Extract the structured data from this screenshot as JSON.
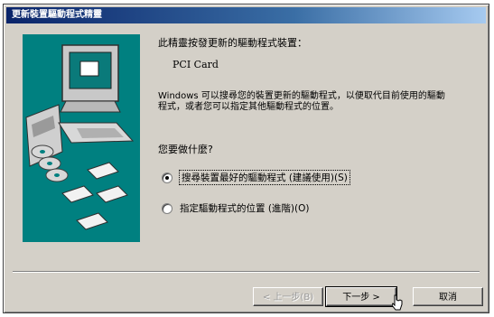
{
  "window": {
    "title": "更新裝置驅動程式精靈"
  },
  "main": {
    "heading": "此精靈按發更新的驅動程式裝置：",
    "device_name": "PCI Card",
    "description": "Windows 可以搜尋您的裝置更新的驅動程式，以便取代目前使用的驅動程式，或者您可以指定其他驅動程式的位置。",
    "question": "您要做什麼?",
    "options": [
      {
        "label": "搜尋裝置最好的驅動程式 (建議使用)(S)",
        "selected": true
      },
      {
        "label": "指定驅動程式的位置 (進階)(O)",
        "selected": false
      }
    ]
  },
  "buttons": {
    "back": "< 上一步(B)",
    "next": "下一步 >",
    "cancel": "取消"
  },
  "colors": {
    "title_start": "#0a246a",
    "title_end": "#a6caf0",
    "panel": "#008080",
    "face": "#d4d0c8"
  },
  "icons": [
    "computer-icon",
    "cd-discs-icon",
    "floppy-disk-icon",
    "cursor-icon"
  ]
}
